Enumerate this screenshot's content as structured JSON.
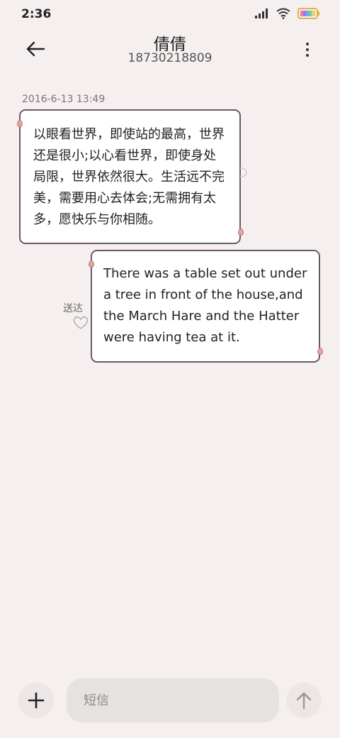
{
  "status_bar": {
    "time": "2:36",
    "signal_icon": "signal-icon",
    "wifi_icon": "wifi-icon",
    "battery_icon": "battery-icon"
  },
  "header": {
    "contact_name": "倩倩",
    "contact_number": "18730218809",
    "back_icon": "back-arrow-icon",
    "more_icon": "more-vertical-icon"
  },
  "conversation": {
    "timestamp": "2016-6-13 13:49",
    "messages": [
      {
        "direction": "incoming",
        "text": "以眼看世界，即使站的最高，世界还是很小;以心看世界，即使身处局限，世界依然很大。生活远不完美，需要用心去体会;无需拥有太多，愿快乐与你相随。"
      },
      {
        "direction": "outgoing",
        "text": "There was a table set out under a tree in front of the house,and the March Hare and the Hatter were having tea at it.",
        "status": "送达"
      }
    ]
  },
  "input_bar": {
    "placeholder": "短信",
    "value": "",
    "add_icon": "plus-icon",
    "send_icon": "send-arrow-icon"
  },
  "colors": {
    "background": "#f6efef",
    "bubble_border": "#6b5a64",
    "bubble_fill": "#ffffff",
    "pin": "#e8a4a0"
  }
}
